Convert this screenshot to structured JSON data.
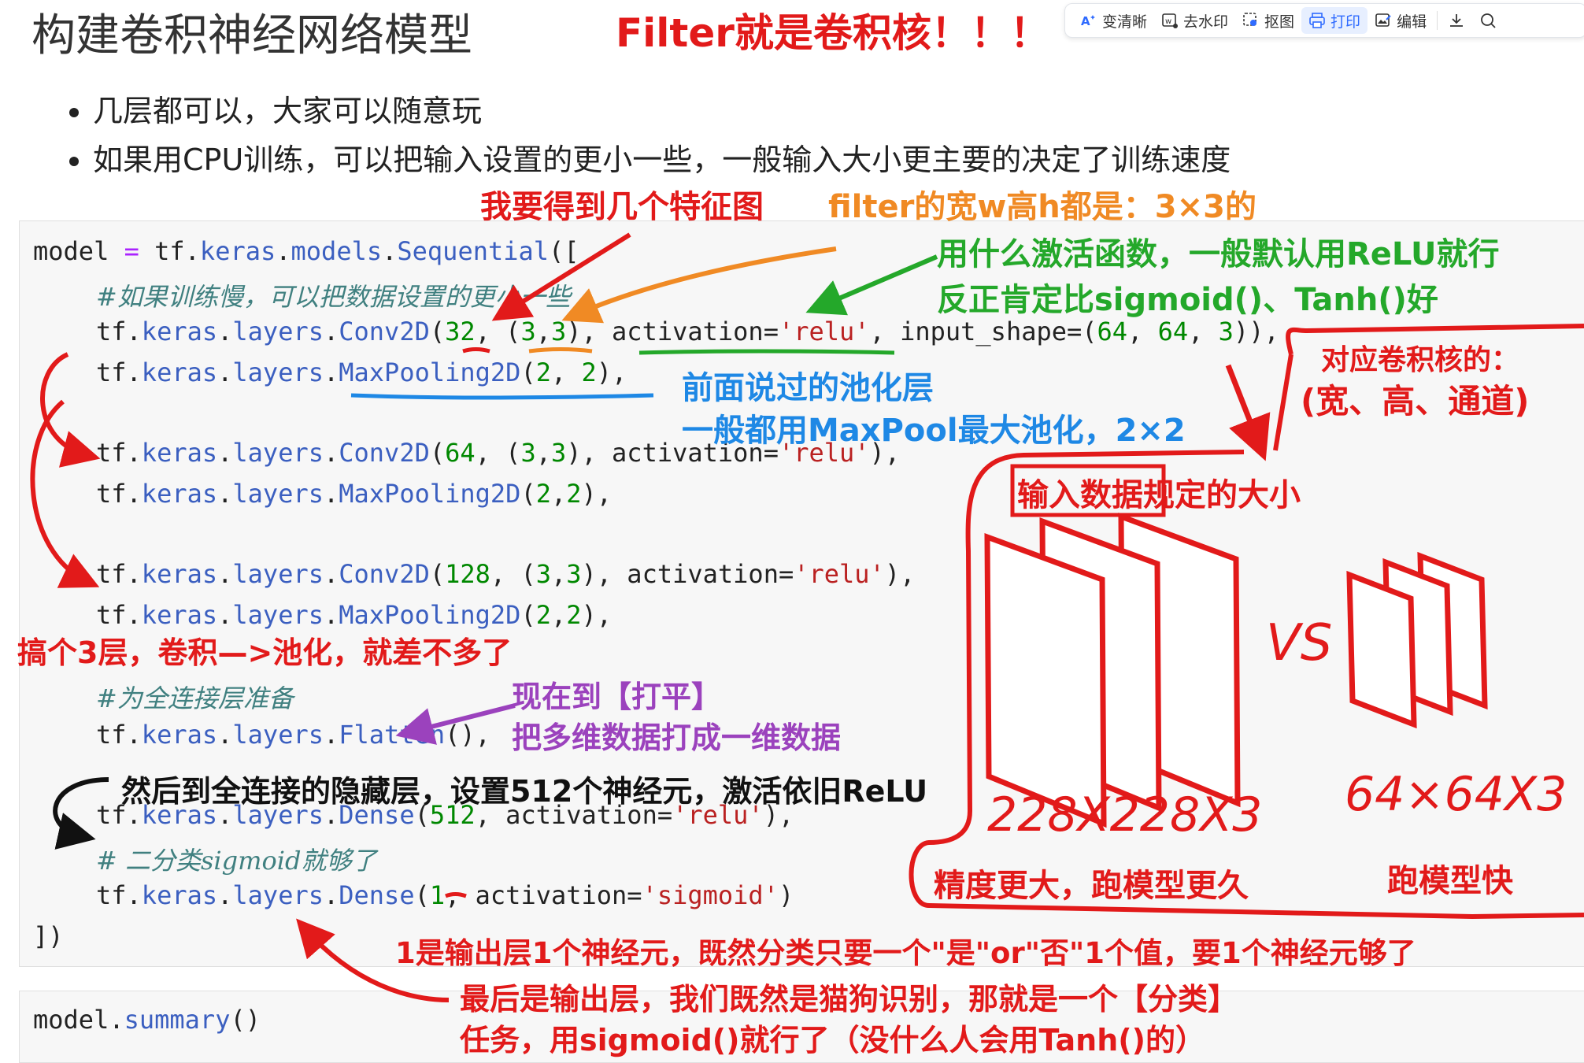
{
  "page": {
    "title": "构建卷积神经网络模型",
    "headline_note": "Filter就是卷积核！！！",
    "bullets": [
      "几层都可以，大家可以随意玩",
      "如果用CPU训练，可以把输入设置的更小一些，一般输入大小更主要的决定了训练速度"
    ]
  },
  "toolbar": {
    "items": [
      {
        "label": "变清晰",
        "icon": "ai-sharpen-icon"
      },
      {
        "label": "去水印",
        "icon": "remove-watermark-icon"
      },
      {
        "label": "抠图",
        "icon": "cutout-icon"
      },
      {
        "label": "打印",
        "icon": "print-icon",
        "active": true
      },
      {
        "label": "编辑",
        "icon": "edit-image-icon"
      }
    ],
    "download_icon": "download-icon",
    "search_icon": "search-icon"
  },
  "code": {
    "line1": {
      "a": "model",
      "b": " = ",
      "c": "tf.",
      "d": "keras",
      "e": ".",
      "f": "models",
      "g": ".",
      "h": "Sequential",
      "i": "(["
    },
    "comment1": "#如果训练慢，可以把数据设置的更小一些",
    "conv1": {
      "prefix": "tf.",
      "keras": "keras",
      "layers": "layers",
      "fn": "Conv2D",
      "open": "(",
      "filters": "32",
      "sep1": ", (",
      "k1": "3",
      "comma": ",",
      "k2": "3",
      "sep2": "), activation=",
      "act": "'relu'",
      "sep3": ", input_shape=(",
      "s1": "64",
      "c1": ", ",
      "s2": "64",
      "c2": ", ",
      "s3": "3",
      "close": ")),"
    },
    "pool1": {
      "fn": "MaxPooling2D",
      "args": "(",
      "a": "2",
      "m": ", ",
      "b": "2",
      "end": "),"
    },
    "conv2": {
      "fn": "Conv2D",
      "filters": "64",
      "k1": "3",
      "k2": "3",
      "act": "'relu'"
    },
    "pool2": {
      "fn": "MaxPooling2D",
      "a": "2",
      "b": "2"
    },
    "conv3": {
      "fn": "Conv2D",
      "filters": "128",
      "k1": "3",
      "k2": "3",
      "act": "'relu'"
    },
    "pool3": {
      "fn": "MaxPooling2D",
      "a": "2",
      "b": "2"
    },
    "comment2": "#为全连接层准备",
    "flatten": {
      "fn": "Flatten",
      "end": "(),"
    },
    "dense1": {
      "fn": "Dense",
      "units": "512",
      "act": "'relu'"
    },
    "comment3": "# 二分类sigmoid就够了",
    "dense2": {
      "fn": "Dense",
      "units": "1",
      "act": "'sigmoid'"
    },
    "closing": "])",
    "summary": {
      "obj": "model",
      "dot": ".",
      "fn": "summary",
      "end": "()"
    }
  },
  "notes": {
    "feature_maps": "我要得到几个特征图",
    "filter_size": "filter的宽w高h都是：3×3的",
    "activation_1": "用什么激活函数，一般默认用ReLU就行",
    "activation_2": "反正肯定比sigmoid()、Tanh()好",
    "channel_1": "对应卷积核的：",
    "channel_2": "(宽、高、通道)",
    "pool_1": "前面说过的池化层",
    "pool_2": "一般都用MaxPool最大池化，2×2",
    "input_size_boxed": "输入数据",
    "input_size_rest": "规定的大小",
    "three_layers": "搞个3层，卷积—>池化，就差不多了",
    "flatten_1": "现在到【打平】",
    "flatten_2": "把多维数据打成一维数据",
    "dense_hidden": "然后到全连接的隐藏层，设置512个神经元，激活依旧ReLU",
    "output_neuron": "1是输出层1个神经元，既然分类只要一个\"是\"or\"否\"1个值，要1个神经元够了",
    "output_layer_1": "最后是输出层，我们既然是猫狗识别，那就是一个【分类】",
    "output_layer_2": "任务，用sigmoid()就行了（没什么人会用Tanh()的）",
    "vs": "VS",
    "size_large": "228X228X3",
    "size_small": "64×64X3",
    "large_desc": "精度更大，跑模型更久",
    "small_desc": "跑模型快"
  },
  "colors": {
    "annotation_red": "#e21a1a",
    "annotation_orange": "#f08a24",
    "annotation_green": "#24a82a",
    "annotation_blue": "#1e88e5",
    "annotation_purple": "#9b42bd",
    "toolbar_active": "#2f6bff"
  }
}
